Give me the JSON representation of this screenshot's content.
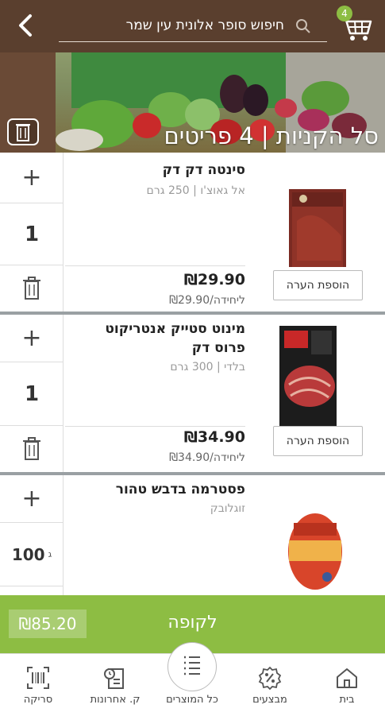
{
  "header": {
    "search_placeholder": "חיפוש סופר אלונית עין שמר",
    "cart_count": "4"
  },
  "banner": {
    "title": "סל הקניות | 4 פריטים"
  },
  "items": [
    {
      "name": "סינטה דק דק",
      "subtitle": "אל גאוצ'ו | 250 גרם",
      "quantity": "1",
      "price": "₪29.90",
      "unit_price": "₪29.90/ליחידה",
      "note_label": "הוספת הערה"
    },
    {
      "name": "מינוט סטייק אנטריקוט פרוס דק",
      "subtitle": "בלדי | 300 גרם",
      "quantity": "1",
      "price": "₪34.90",
      "unit_price": "₪34.90/ליחידה",
      "note_label": "הוספת הערה"
    },
    {
      "name": "פסטרמה בדבש טהור",
      "subtitle": "זוגלובק",
      "quantity": "100",
      "quantity_unit": "ג"
    }
  ],
  "checkout": {
    "label": "לקופה",
    "total": "₪85.20"
  },
  "bottom_nav": [
    {
      "label": "בית",
      "icon": "home-icon"
    },
    {
      "label": "מבצעים",
      "icon": "percent-icon"
    },
    {
      "label": "כל המוצרים",
      "icon": "list-icon"
    },
    {
      "label": "ק. אחרונות",
      "icon": "history-icon"
    },
    {
      "label": "סריקה",
      "icon": "barcode-icon"
    }
  ],
  "colors": {
    "header_brown": "#5a3f2e",
    "accent_green": "#8dbd43"
  }
}
